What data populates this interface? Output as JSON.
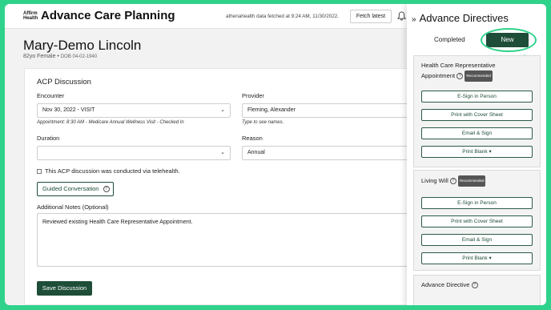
{
  "header": {
    "logo_line1": "Affirm",
    "logo_line2": "Health",
    "app_title": "Advance Care Planning",
    "fetched_text": "athenahealth data fetched at 9:24 AM, 11/30/2022.",
    "fetch_button": "Fetch latest"
  },
  "patient": {
    "name": "Mary-Demo Lincoln",
    "age_sex": "82yo Female •",
    "dob": "DOB 04-02-1940"
  },
  "acp": {
    "title": "ACP Discussion",
    "encounter_label": "Encounter",
    "encounter_value": "Nov 30, 2022 - VISIT",
    "appointment_hint": "Appointment: 8:30 AM - Medicare Annual Wellness Visit - Checked In",
    "provider_label": "Provider",
    "provider_value": "Fleming, Alexander",
    "provider_hint": "Type to see names.",
    "duration_label": "Duration",
    "duration_value": "",
    "reason_label": "Reason",
    "reason_value": "Annual",
    "telehealth_label": "This ACP discussion was conducted via telehealth.",
    "telehealth_checked": false,
    "guided_button": "Guided Conversation",
    "notes_label": "Additional Notes (Optional)",
    "notes_value": "Reviewed existing Health Care Representative Appointment.",
    "save_button": "Save Discussion"
  },
  "panel": {
    "title": "Advance Directives",
    "tab_completed": "Completed",
    "tab_new": "New",
    "directives": [
      {
        "title_line1": "Health Care Representative",
        "title_line2": "Appointment",
        "badge": "Recommended",
        "buttons": [
          "E-Sign in Person",
          "Print with Cover Sheet",
          "Email & Sign",
          "Print Blank"
        ]
      },
      {
        "title_line1": "Living Will",
        "badge": "Recommended",
        "buttons": [
          "E-Sign in Person",
          "Print with Cover Sheet",
          "Email & Sign",
          "Print Blank"
        ]
      },
      {
        "title_line1": "Advance Directive"
      }
    ]
  },
  "colors": {
    "brand_green": "#1e4d38",
    "accent_mint": "#2fd28b"
  }
}
